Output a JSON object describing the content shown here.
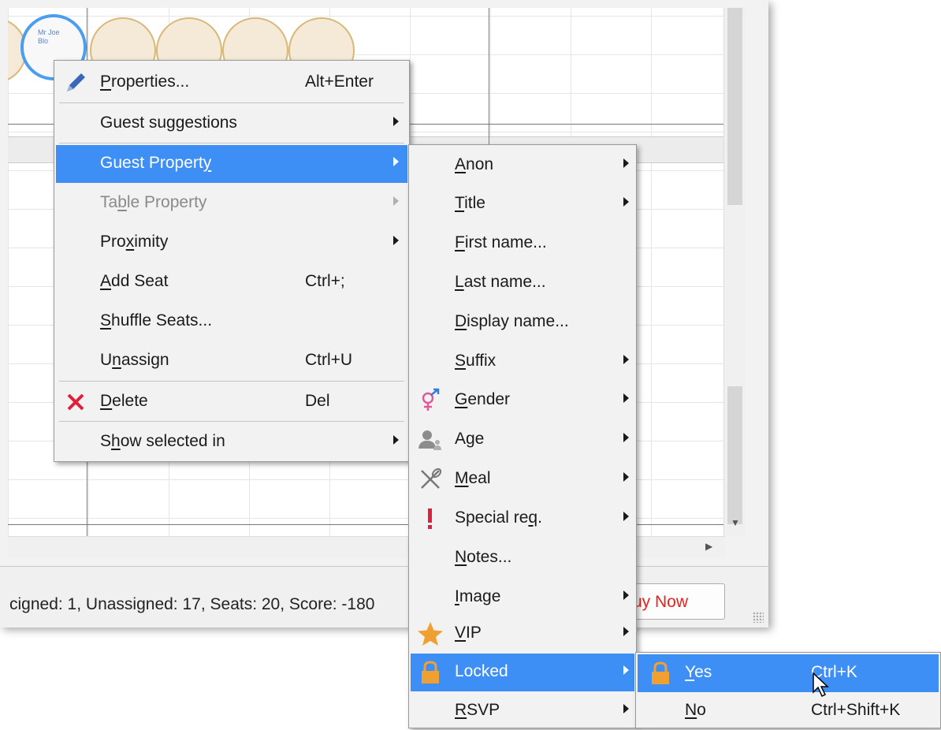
{
  "seat": {
    "label_line1": "Mr Joe",
    "label_line2": "Blo"
  },
  "status": {
    "text": "cigned: 1, Unassigned: 17, Seats: 20, Score: -180",
    "buy_button_label": "uy Now"
  },
  "colors": {
    "highlight": "#3d8ff5",
    "buy_text": "#e8211c",
    "delete_x": "#e0203a",
    "seat_border": "#d9b87a",
    "selected_seat_border": "#4a9df0"
  },
  "context_menu": {
    "items": [
      {
        "pre": "",
        "u": "P",
        "post": "roperties...",
        "shortcut": "Alt+Enter",
        "icon": "pencil-icon"
      },
      {
        "label": "Guest suggestions"
      },
      {
        "label": "Guest Propert",
        "u": "y"
      },
      {
        "pre": "Ta",
        "u": "b",
        "post": "le Property"
      },
      {
        "pre": "Pro",
        "u": "x",
        "post": "imity"
      },
      {
        "pre": "",
        "u": "A",
        "post": "dd Seat",
        "shortcut": "Ctrl+;"
      },
      {
        "pre": "",
        "u": "S",
        "post": "huffle Seats..."
      },
      {
        "pre": "U",
        "u": "n",
        "post": "assign",
        "shortcut": "Ctrl+U"
      },
      {
        "pre": "",
        "u": "D",
        "post": "elete",
        "shortcut": "Del",
        "icon": "delete-x-icon"
      },
      {
        "pre": "S",
        "u": "h",
        "post": "ow selected in"
      }
    ]
  },
  "guest_property_menu": {
    "items": [
      {
        "pre": "",
        "u": "A",
        "post": "non"
      },
      {
        "pre": "",
        "u": "T",
        "post": "itle"
      },
      {
        "pre": "",
        "u": "F",
        "post": "irst name..."
      },
      {
        "pre": "",
        "u": "L",
        "post": "ast name..."
      },
      {
        "pre": "",
        "u": "D",
        "post": "isplay name..."
      },
      {
        "pre": "",
        "u": "S",
        "post": "uffix"
      },
      {
        "pre": "",
        "u": "G",
        "post": "ender",
        "icon": "gender-icon"
      },
      {
        "label": "Age",
        "icon": "age-person-icon"
      },
      {
        "pre": "",
        "u": "M",
        "post": "eal",
        "icon": "cutlery-icon"
      },
      {
        "pre": "Special re",
        "u": "q",
        "post": ".",
        "icon": "exclamation-icon"
      },
      {
        "pre": "",
        "u": "N",
        "post": "otes..."
      },
      {
        "pre": "",
        "u": "I",
        "post": "mage"
      },
      {
        "pre": "",
        "u": "V",
        "post": "IP",
        "icon": "star-icon"
      },
      {
        "label": "Locked",
        "icon": "lock-icon"
      },
      {
        "pre": "",
        "u": "R",
        "post": "SVP"
      }
    ]
  },
  "locked_menu": {
    "items": [
      {
        "pre": "",
        "u": "Y",
        "post": "es",
        "shortcut": "Ctrl+K",
        "icon": "lock-icon"
      },
      {
        "pre": "",
        "u": "N",
        "post": "o",
        "shortcut": "Ctrl+Shift+K"
      }
    ]
  }
}
